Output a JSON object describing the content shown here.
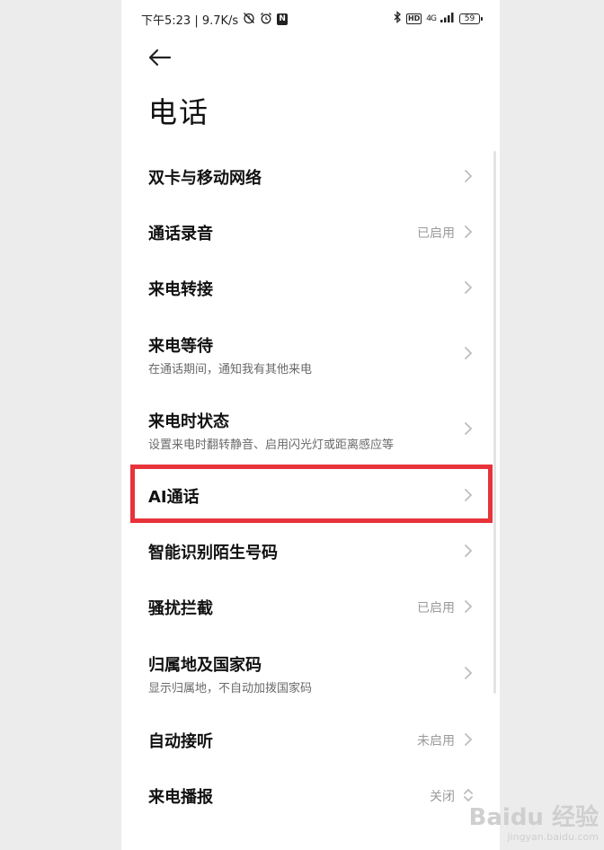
{
  "status_bar": {
    "time_speed": "下午5:23 | 9.7K/s",
    "notification_badge": "N",
    "hd_label": "HD",
    "network_label": "4G",
    "battery_level": "59"
  },
  "header": {
    "title": "电话"
  },
  "settings_items": [
    {
      "title": "双卡与移动网络",
      "subtitle": "",
      "value": ""
    },
    {
      "title": "通话录音",
      "subtitle": "",
      "value": "已启用"
    },
    {
      "title": "来电转接",
      "subtitle": "",
      "value": ""
    },
    {
      "title": "来电等待",
      "subtitle": "在通话期间，通知我有其他来电",
      "value": ""
    },
    {
      "title": "来电时状态",
      "subtitle": "设置来电时翻转静音、启用闪光灯或距离感应等",
      "value": ""
    },
    {
      "title": "AI通话",
      "subtitle": "",
      "value": ""
    },
    {
      "title": "智能识别陌生号码",
      "subtitle": "",
      "value": ""
    },
    {
      "title": "骚扰拦截",
      "subtitle": "",
      "value": "已启用"
    },
    {
      "title": "归属地及国家码",
      "subtitle": "显示归属地，不自动加拨国家码",
      "value": ""
    },
    {
      "title": "自动接听",
      "subtitle": "",
      "value": "未启用"
    },
    {
      "title": "来电播报",
      "subtitle": "",
      "value": "关闭"
    }
  ],
  "watermark": {
    "brand": "Baidu 经验",
    "url": "jingyan.baidu.com"
  },
  "colors": {
    "highlight": "#e8333b",
    "chevron": "#bdbdbd",
    "secondary_text": "#9a9a9a"
  }
}
